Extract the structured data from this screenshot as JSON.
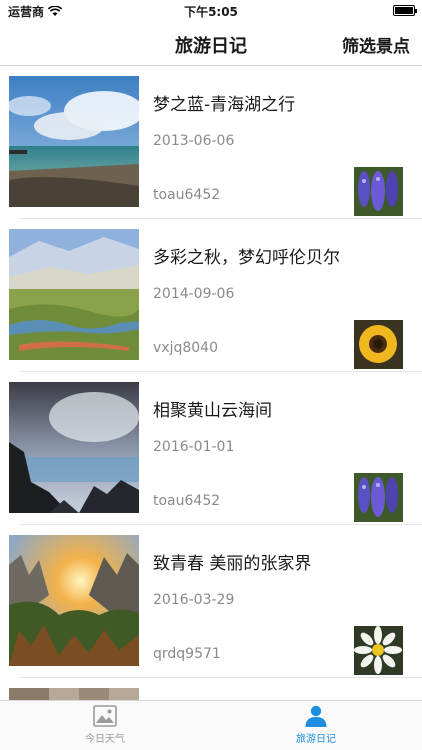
{
  "status_bar": {
    "carrier": "运营商",
    "time": "下午5:05"
  },
  "nav": {
    "title": "旅游日记",
    "action_label": "筛选景点"
  },
  "diaries": [
    {
      "title": "梦之蓝-青海湖之行",
      "date": "2013-06-06",
      "author": "toau6452",
      "photo": "lake-landscape",
      "avatar": "purple-flowers"
    },
    {
      "title": "多彩之秋，梦幻呼伦贝尔",
      "date": "2014-09-06",
      "author": "vxjq8040",
      "photo": "grassland-river",
      "avatar": "sunflower"
    },
    {
      "title": "相聚黄山云海间",
      "date": "2016-01-01",
      "author": "toau6452",
      "photo": "mountain-clouds",
      "avatar": "purple-flowers"
    },
    {
      "title": "致青春   美丽的张家界",
      "date": "2016-03-29",
      "author": "qrdq9571",
      "photo": "sunrise-peaks",
      "avatar": "daisy"
    }
  ],
  "tabs": [
    {
      "label": "今日天气",
      "icon": "image-icon",
      "active": false
    },
    {
      "label": "旅游日记",
      "icon": "person-icon",
      "active": true
    }
  ],
  "colors": {
    "accent": "#1e8fe0",
    "secondary_text": "#8a8a8a",
    "inactive_tab": "#9a9a9a"
  }
}
